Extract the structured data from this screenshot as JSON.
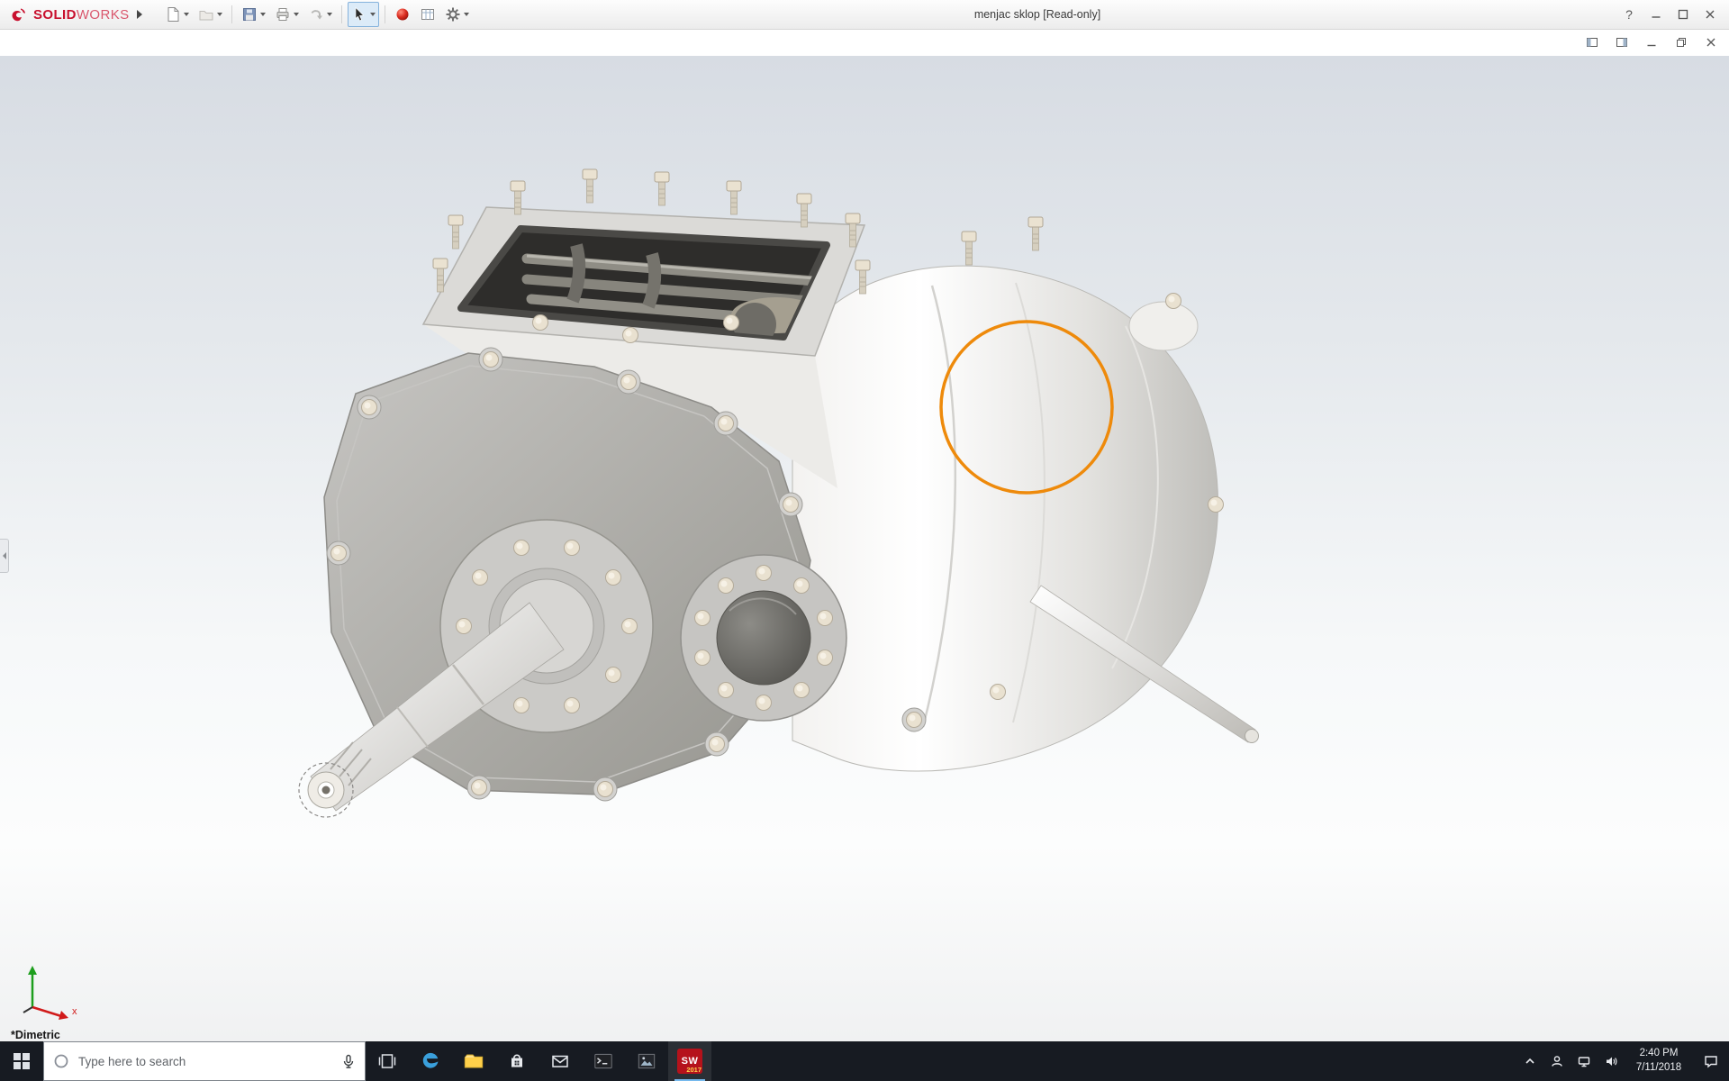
{
  "window": {
    "brand": {
      "primary": "SOLID",
      "secondary": "WORKS"
    },
    "document_title": "menjac sklop [Read-only]",
    "help_glyph": "?",
    "controls": [
      "help",
      "minimize",
      "maximize",
      "close"
    ]
  },
  "toolbar": {
    "icons": [
      {
        "name": "new-document",
        "enabled": true,
        "has_dropdown": true
      },
      {
        "name": "open",
        "enabled": false,
        "has_dropdown": true
      },
      {
        "name": "save",
        "enabled": true,
        "has_dropdown": true
      },
      {
        "name": "print",
        "enabled": true,
        "has_dropdown": true
      },
      {
        "name": "undo",
        "enabled": false,
        "has_dropdown": true
      },
      {
        "name": "select-cursor",
        "enabled": true,
        "selected": true,
        "has_dropdown": true
      },
      {
        "name": "appearances-sphere",
        "enabled": true,
        "has_dropdown": false
      },
      {
        "name": "design-table",
        "enabled": true,
        "has_dropdown": false
      },
      {
        "name": "options-gear",
        "enabled": true,
        "has_dropdown": true
      }
    ]
  },
  "document_window": {
    "controls": [
      "pane-left",
      "pane-right",
      "minimize",
      "restore",
      "close"
    ]
  },
  "viewport": {
    "view_orientation": "*Dimetric",
    "annotation": {
      "shape": "circle",
      "color": "#EE8A0B"
    },
    "triad": {
      "x_label": "x"
    }
  },
  "taskbar": {
    "search_placeholder": "Type here to search",
    "apps": [
      "task-view",
      "edge",
      "file-explorer",
      "store",
      "mail",
      "command-prompt",
      "photos",
      "solidworks-2017"
    ],
    "solidworks_badge": {
      "label": "SW",
      "year": "2017"
    },
    "tray": {
      "icons": [
        "hidden-icons-chevron",
        "people",
        "network",
        "volume"
      ],
      "time": "2:40 PM",
      "date": "7/11/2018",
      "action_center": "action-center"
    }
  },
  "colors": {
    "brand_red": "#C8102E",
    "annotation_orange": "#EE8A0B",
    "taskbar_bg": "#171B22",
    "active_accent": "#76B9ED"
  }
}
